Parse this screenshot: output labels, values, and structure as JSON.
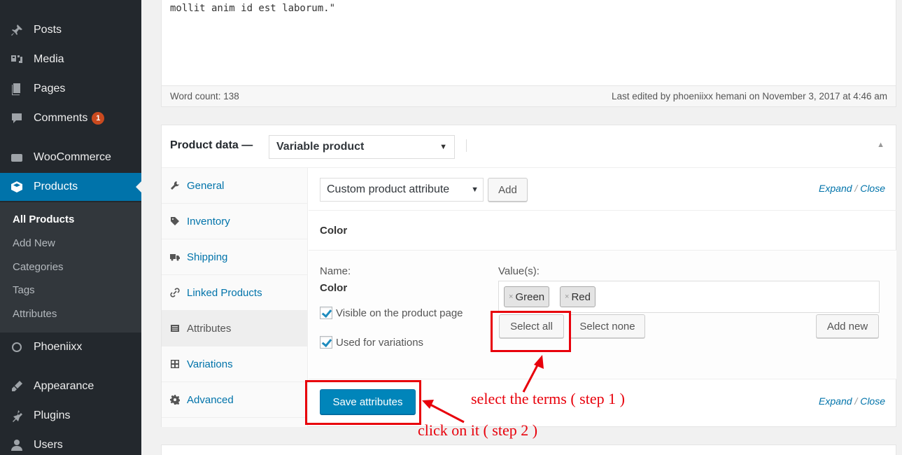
{
  "sidebar": {
    "items": [
      {
        "label": "Posts",
        "icon": "pin-icon"
      },
      {
        "label": "Media",
        "icon": "media-icon"
      },
      {
        "label": "Pages",
        "icon": "pages-icon"
      },
      {
        "label": "Comments",
        "icon": "comments-icon",
        "badge": "1"
      },
      {
        "label": "WooCommerce",
        "icon": "woo-icon"
      },
      {
        "label": "Products",
        "icon": "products-icon",
        "active": true
      },
      {
        "label": "Phoeniixx",
        "icon": "phoeniixx-icon"
      },
      {
        "label": "Appearance",
        "icon": "brush-icon"
      },
      {
        "label": "Plugins",
        "icon": "plugin-icon"
      },
      {
        "label": "Users",
        "icon": "users-icon"
      }
    ],
    "submenu": [
      {
        "label": "All Products",
        "current": true
      },
      {
        "label": "Add New"
      },
      {
        "label": "Categories"
      },
      {
        "label": "Tags"
      },
      {
        "label": "Attributes"
      }
    ]
  },
  "editor": {
    "text": "mollit anim id est laborum.\"",
    "word_count": "Word count: 138",
    "last_edited": "Last edited by phoeniixx hemani on November 3, 2017 at 4:46 am"
  },
  "product_data": {
    "title": "Product data —",
    "type_selected": "Variable product",
    "tabs": [
      {
        "label": "General",
        "icon": "wrench-icon"
      },
      {
        "label": "Inventory",
        "icon": "tag-icon"
      },
      {
        "label": "Shipping",
        "icon": "truck-icon"
      },
      {
        "label": "Linked Products",
        "icon": "link-icon"
      },
      {
        "label": "Attributes",
        "icon": "list-icon",
        "active": true
      },
      {
        "label": "Variations",
        "icon": "grid-icon"
      },
      {
        "label": "Advanced",
        "icon": "gear-icon"
      }
    ],
    "attributes": {
      "select_value": "Custom product attribute",
      "add_label": "Add",
      "expand": "Expand",
      "slash": "/",
      "close": "Close",
      "attr_name": "Color",
      "name_label": "Name:",
      "name_value": "Color",
      "values_label": "Value(s):",
      "values": [
        "Green",
        "Red"
      ],
      "remove_mark": "×",
      "visible_label": "Visible on the product page",
      "variations_label": "Used for variations",
      "select_all": "Select all",
      "select_none": "Select none",
      "add_new": "Add new",
      "save_label": "Save attributes"
    }
  },
  "annotations": {
    "step1": "select the terms ( step 1 )",
    "step2": "click on it ( step 2 )",
    "color": "#e8000b"
  }
}
